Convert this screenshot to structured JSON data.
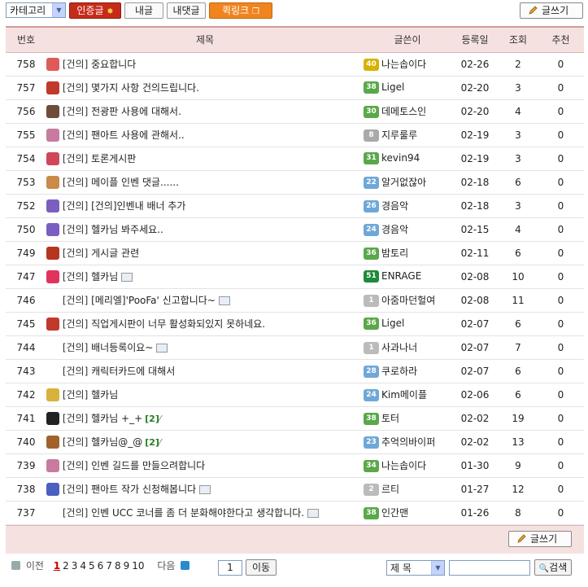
{
  "toolbar": {
    "category_select": "카테고리",
    "certified_label": "인증글",
    "my_posts_label": "내글",
    "my_comments_label": "내댓글",
    "link_label": "퀵링크",
    "write_label": "글쓰기"
  },
  "table": {
    "headers": [
      "번호",
      "제목",
      "글쓴이",
      "등록일",
      "조회",
      "추천"
    ],
    "rows": [
      {
        "num": "758",
        "pic": "#e05a5a",
        "tag": "[건의]",
        "title": "중요합니다",
        "lvl": "40",
        "lvlc": "#d8b200",
        "author": "나는솝이다",
        "date": "02-26",
        "views": "2",
        "rec": "0",
        "img": false,
        "cmt": ""
      },
      {
        "num": "757",
        "pic": "#c0392b",
        "tag": "[건의]",
        "title": "몇가지 사항 건의드립니다.",
        "lvl": "38",
        "lvlc": "#5aa84a",
        "author": "Ligel",
        "date": "02-20",
        "views": "3",
        "rec": "0",
        "img": false,
        "cmt": ""
      },
      {
        "num": "756",
        "pic": "#6e4b3a",
        "tag": "[건의]",
        "title": "전광판 사용에 대해서.",
        "lvl": "30",
        "lvlc": "#5aa84a",
        "author": "데메토스인",
        "date": "02-20",
        "views": "4",
        "rec": "0",
        "img": false,
        "cmt": ""
      },
      {
        "num": "755",
        "pic": "#c87b9e",
        "tag": "[건의]",
        "title": "팬아트 사용에 관해서..",
        "lvl": "8",
        "lvlc": "#aaaaaa",
        "author": "지루룰루",
        "date": "02-19",
        "views": "3",
        "rec": "0",
        "img": false,
        "cmt": ""
      },
      {
        "num": "754",
        "pic": "#d0465a",
        "tag": "[건의]",
        "title": "토론게시판",
        "lvl": "31",
        "lvlc": "#5aa84a",
        "author": "kevin94",
        "date": "02-19",
        "views": "3",
        "rec": "0",
        "img": false,
        "cmt": ""
      },
      {
        "num": "753",
        "pic": "#c98a4a",
        "tag": "[건의]",
        "title": "메이플 인벤 댓글......",
        "lvl": "22",
        "lvlc": "#6fa8d8",
        "author": "알거없잖아",
        "date": "02-18",
        "views": "6",
        "rec": "0",
        "img": false,
        "cmt": ""
      },
      {
        "num": "752",
        "pic": "#7a5fc0",
        "tag": "[건의]",
        "title": "[건의]인벤내 배너 추가",
        "lvl": "26",
        "lvlc": "#6fa8d8",
        "author": "경음악",
        "date": "02-18",
        "views": "3",
        "rec": "0",
        "img": false,
        "cmt": ""
      },
      {
        "num": "750",
        "pic": "#7a5fc0",
        "tag": "[건의]",
        "title": "헬카님 봐주세요..",
        "lvl": "24",
        "lvlc": "#6fa8d8",
        "author": "경음악",
        "date": "02-15",
        "views": "4",
        "rec": "0",
        "img": false,
        "cmt": ""
      },
      {
        "num": "749",
        "pic": "#b5361f",
        "tag": "[건의]",
        "title": "게시글 관련",
        "lvl": "36",
        "lvlc": "#5aa84a",
        "author": "밤토리",
        "date": "02-11",
        "views": "6",
        "rec": "0",
        "img": false,
        "cmt": ""
      },
      {
        "num": "747",
        "pic": "#e0335e",
        "tag": "[건의]",
        "title": "헬카님",
        "lvl": "51",
        "lvlc": "#1e8a3a",
        "author": "ENRAGE",
        "date": "02-08",
        "views": "10",
        "rec": "0",
        "img": true,
        "cmt": ""
      },
      {
        "num": "746",
        "pic": "",
        "tag": "[건의]",
        "title": "[메리엘]'PooFa' 신고합니다~",
        "lvl": "1",
        "lvlc": "#bbbbbb",
        "author": "아줌마던헐여",
        "date": "02-08",
        "views": "11",
        "rec": "0",
        "img": true,
        "cmt": ""
      },
      {
        "num": "745",
        "pic": "#c0392b",
        "tag": "[건의]",
        "title": "직업게시판이 너무 활성화되있지 못하네요.",
        "lvl": "36",
        "lvlc": "#5aa84a",
        "author": "Ligel",
        "date": "02-07",
        "views": "6",
        "rec": "0",
        "img": false,
        "cmt": ""
      },
      {
        "num": "744",
        "pic": "",
        "tag": "[건의]",
        "title": "배너등록이요~",
        "lvl": "1",
        "lvlc": "#bbbbbb",
        "author": "사과나너",
        "date": "02-07",
        "views": "7",
        "rec": "0",
        "img": true,
        "cmt": ""
      },
      {
        "num": "743",
        "pic": "",
        "tag": "[건의]",
        "title": "캐릭터카드에 대해서",
        "lvl": "28",
        "lvlc": "#6fa8d8",
        "author": "쿠로하라",
        "date": "02-07",
        "views": "6",
        "rec": "0",
        "img": false,
        "cmt": ""
      },
      {
        "num": "742",
        "pic": "#d8b23a",
        "tag": "[건의]",
        "title": "헬카님",
        "lvl": "24",
        "lvlc": "#6fa8d8",
        "author": "Kim메이플",
        "date": "02-06",
        "views": "6",
        "rec": "0",
        "img": false,
        "cmt": ""
      },
      {
        "num": "741",
        "pic": "#222222",
        "tag": "[건의]",
        "title": "헬카님 +_+",
        "lvl": "38",
        "lvlc": "#5aa84a",
        "author": "토터",
        "date": "02-02",
        "views": "19",
        "rec": "0",
        "img": false,
        "cmt": "[2]"
      },
      {
        "num": "740",
        "pic": "#a0622a",
        "tag": "[건의]",
        "title": "헬카님@_@",
        "lvl": "23",
        "lvlc": "#6fa8d8",
        "author": "추억의바이퍼",
        "date": "02-02",
        "views": "13",
        "rec": "0",
        "img": false,
        "cmt": "[2]"
      },
      {
        "num": "739",
        "pic": "#c87b9e",
        "tag": "[건의]",
        "title": "인벤 길드를 만들으려합니다",
        "lvl": "34",
        "lvlc": "#5aa84a",
        "author": "나는솝이다",
        "date": "01-30",
        "views": "9",
        "rec": "0",
        "img": false,
        "cmt": ""
      },
      {
        "num": "738",
        "pic": "#4a5fc0",
        "tag": "[건의]",
        "title": "팬아트 작가 신청해봅니다",
        "lvl": "2",
        "lvlc": "#bbbbbb",
        "author": "르티",
        "date": "01-27",
        "views": "12",
        "rec": "0",
        "img": true,
        "cmt": ""
      },
      {
        "num": "737",
        "pic": "",
        "tag": "[건의]",
        "title": "인벤 UCC 코너를 좀 더 분화해야한다고 생각합니다.",
        "lvl": "38",
        "lvlc": "#5aa84a",
        "author": "인간맨",
        "date": "01-26",
        "views": "8",
        "rec": "0",
        "img": true,
        "cmt": ""
      }
    ]
  },
  "footer": {
    "write_label": "글쓰기",
    "prev_label": "이전",
    "pages": [
      "1",
      "2",
      "3",
      "4",
      "5",
      "6",
      "7",
      "8",
      "9",
      "10"
    ],
    "current_page": "1",
    "next_label": "다음",
    "page_input": "1",
    "go_label": "이동",
    "search_field": "제 목",
    "search_input": "",
    "search_label": "검색"
  },
  "colors": {
    "header_bg": "#f6e1e1",
    "accent_red": "#c62b1a",
    "accent_orange": "#f0841e"
  }
}
